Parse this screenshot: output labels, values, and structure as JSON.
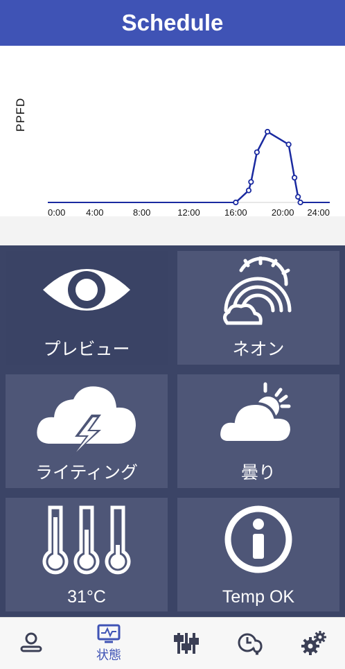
{
  "header": {
    "title": "Schedule"
  },
  "chart_data": {
    "type": "line",
    "ylabel": "PPFD",
    "xlabel": "",
    "x_ticks": [
      "0:00",
      "4:00",
      "8:00",
      "12:00",
      "16:00",
      "20:00",
      "24:00"
    ],
    "xlim": [
      0,
      24
    ],
    "ylim": [
      0,
      100
    ],
    "series": [
      {
        "color": "#1a2aa0",
        "x": [
          16.0,
          17.1,
          17.3,
          17.8,
          18.7,
          20.5,
          21.0,
          21.3,
          21.5
        ],
        "y": [
          0,
          17,
          29,
          71,
          100,
          82,
          35,
          8,
          0
        ]
      }
    ]
  },
  "tiles": [
    {
      "label": "プレビュー",
      "icon": "eye-icon",
      "selected": true
    },
    {
      "label": "ネオン",
      "icon": "rainbow-icon",
      "selected": false
    },
    {
      "label": "ライティング",
      "icon": "thunderstorm-icon",
      "selected": false
    },
    {
      "label": "曇り",
      "icon": "cloudy-icon",
      "selected": false
    },
    {
      "label": "31°C",
      "icon": "thermometers-icon",
      "selected": false
    },
    {
      "label": "Temp OK",
      "icon": "info-icon",
      "selected": false
    }
  ],
  "bottom_nav": {
    "items": [
      {
        "icon": "user-icon",
        "label": ""
      },
      {
        "icon": "monitor-icon",
        "label": "状態"
      },
      {
        "icon": "sliders-icon",
        "label": ""
      },
      {
        "icon": "clock-bulb-icon",
        "label": ""
      },
      {
        "icon": "gears-icon",
        "label": ""
      }
    ]
  },
  "colors": {
    "header": "#3f53b5",
    "tile": "#4e5677",
    "background": "#3b4466",
    "line": "#1a2aa0"
  }
}
